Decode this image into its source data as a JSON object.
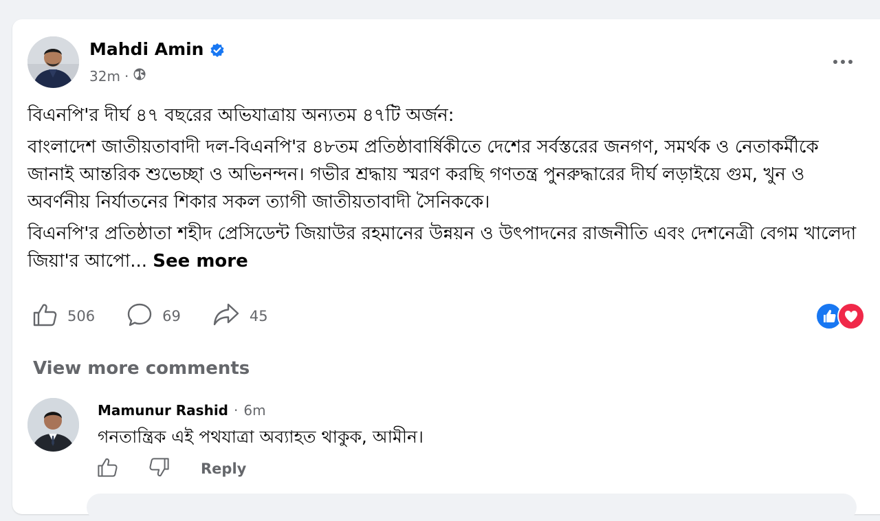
{
  "post": {
    "author": "Mahdi Amin",
    "time": "32m",
    "separator": "·",
    "paragraphs": [
      "বিএনপি'র দীর্ঘ ৪৭ বছরের অভিযাত্রায় অন্যতম ৪৭টি অর্জন:",
      "বাংলাদেশ জাতীয়তাবাদী দল-বিএনপি'র ৪৮তম প্রতিষ্ঠাবার্ষিকীতে দেশের সর্বস্তরের জনগণ, সমর্থক ও নেতাকর্মীকে জানাই আন্তরিক শুভেচ্ছা ও অভিনন্দন। গভীর শ্রদ্ধায় স্মরণ করছি গণতন্ত্র পুনরুদ্ধারের দীর্ঘ লড়াইয়ে গুম, খুন ও অবর্ণনীয় নির্যাতনের শিকার সকল ত্যাগী জাতীয়তাবাদী সৈনিককে।",
      "বিএনপি'র প্রতিষ্ঠাতা শহীদ প্রেসিডেন্ট জিয়াউর রহমানের উন্নয়ন ও উৎপাদনের রাজনীতি এবং দেশনেত্রী বেগম খালেদা জিয়া'র আপো..."
    ],
    "see_more": "See more",
    "likes": "506",
    "comments": "69",
    "shares": "45"
  },
  "comments_section": {
    "view_more": "View more comments",
    "comment": {
      "author": "Mamunur Rashid",
      "separator": "·",
      "time": "6m",
      "text": "গনতান্ত্রিক এই পথযাত্রা অব্যাহত থাকুক, আমীন।",
      "reply": "Reply"
    }
  },
  "colors": {
    "brand_blue": "#1877f2",
    "love_red": "#f02849",
    "secondary_text": "#65676b"
  }
}
